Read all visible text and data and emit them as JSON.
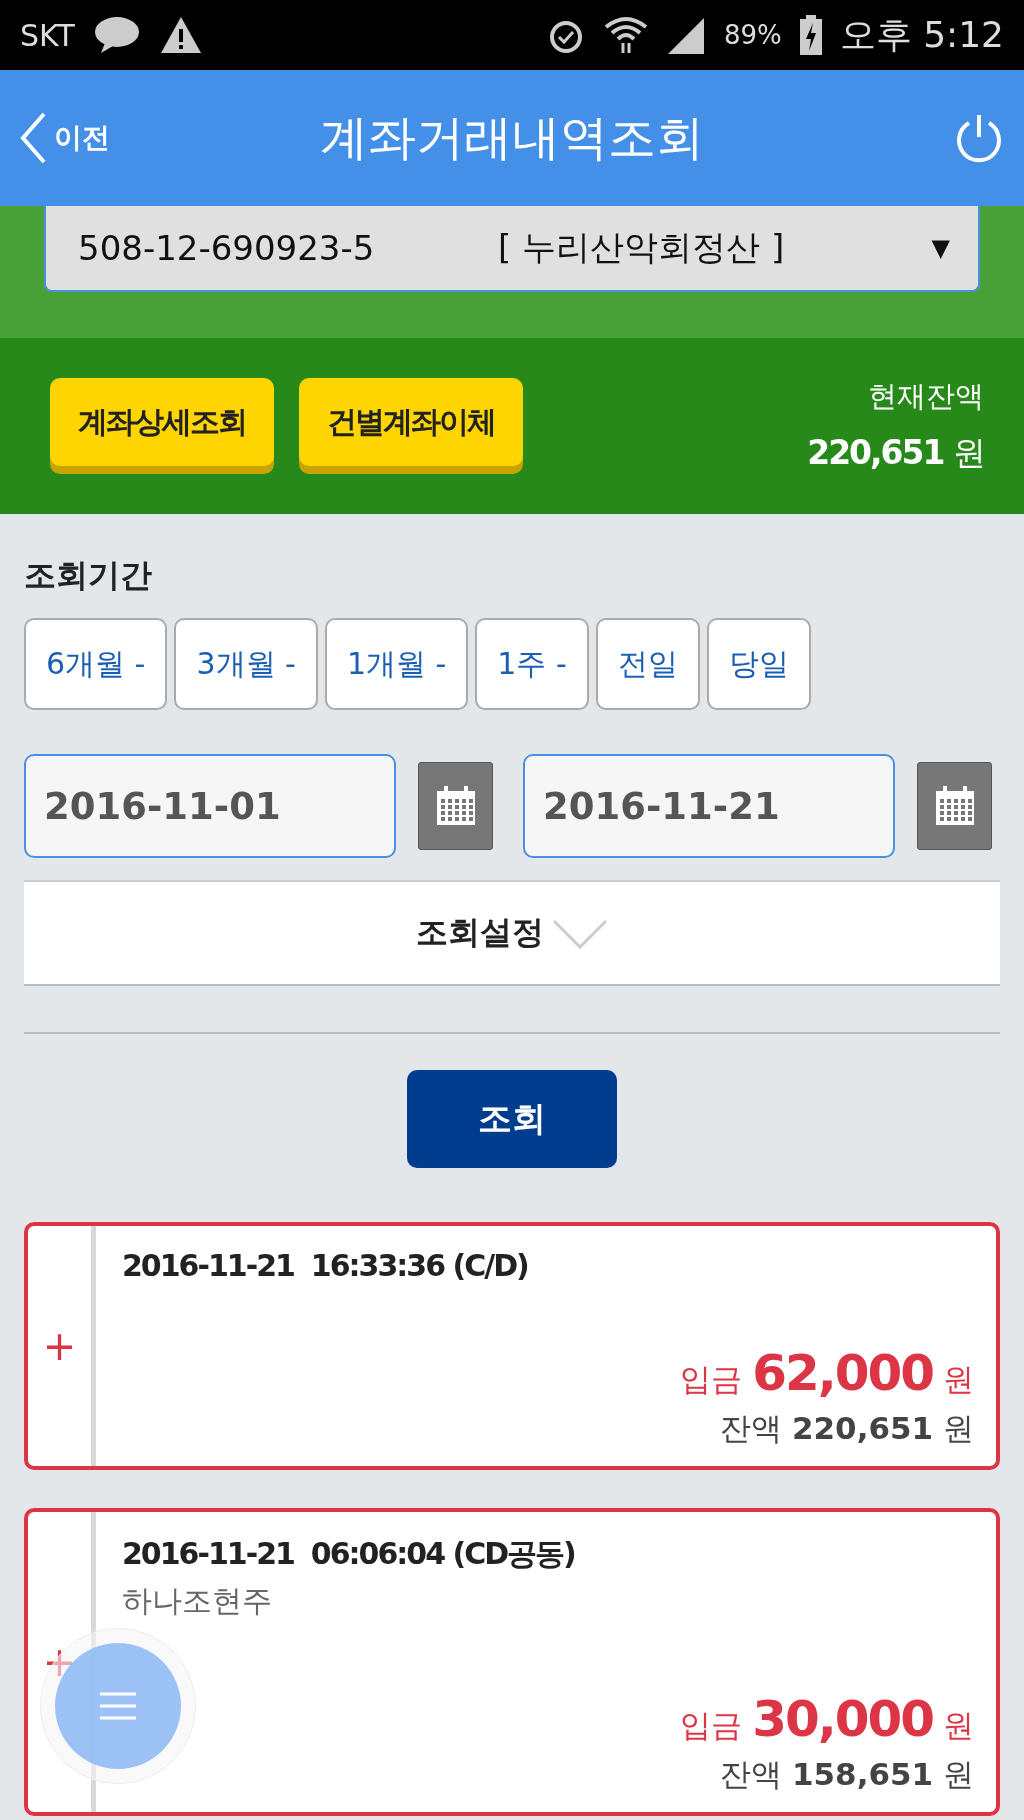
{
  "status_bar": {
    "carrier": "SKT",
    "battery": "89%",
    "time": "오후 5:12"
  },
  "header": {
    "back_label": "이전",
    "title": "계좌거래내역조회"
  },
  "account": {
    "number": "508-12-690923-5",
    "name": "[ 누리산악회정산 ]",
    "arrow": "▼"
  },
  "actions": [
    "계좌상세조회",
    "건별계좌이체"
  ],
  "balance": {
    "label": "현재잔액",
    "amount": "220,651",
    "unit": "원"
  },
  "period": {
    "label": "조회기간",
    "options": [
      {
        "label": "6개월 -",
        "selected": false
      },
      {
        "label": "3개월 -",
        "selected": false
      },
      {
        "label": "1개월 -",
        "selected": false
      },
      {
        "label": "1주 -",
        "selected": false
      },
      {
        "label": "전일",
        "selected": false
      },
      {
        "label": "당일",
        "selected": false
      }
    ],
    "start_date": "2016-11-01",
    "end_date": "2016-11-21"
  },
  "settings": {
    "label": "조회설정",
    "expanded": false
  },
  "search_button": "조회",
  "transactions": [
    {
      "toggle": "+",
      "datetime": "2016-11-21  16:33:36 (C/D)",
      "type": "입금",
      "amount": "62,000",
      "unit": "원",
      "balance_label": "잔액",
      "balance": "220,651",
      "balance_unit": "원"
    },
    {
      "toggle": "+",
      "datetime": "2016-11-21  06:06:04 (CD공동)",
      "memo": "하나조현주",
      "type": "입금",
      "amount": "30,000",
      "unit": "원",
      "balance_label": "잔액",
      "balance": "158,651",
      "balance_unit": "원"
    }
  ]
}
